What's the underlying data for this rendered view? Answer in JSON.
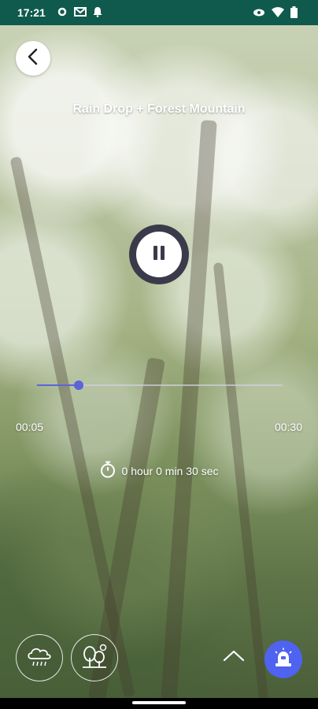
{
  "status_bar": {
    "time": "17:21",
    "left_icons": [
      "settings-icon",
      "gmail-icon",
      "notification-bell-icon"
    ],
    "right_icons": [
      "eye-icon",
      "wifi-icon",
      "battery-icon"
    ]
  },
  "player": {
    "title": "Rain Drop + Forest Mountain",
    "state": "playing",
    "progress_fraction": 0.17,
    "current_time": "00:05",
    "total_time": "00:30",
    "timer_text": "0 hour 0 min 30 sec"
  },
  "sounds": [
    {
      "icon": "rain-cloud-icon"
    },
    {
      "icon": "forest-trees-icon"
    }
  ],
  "colors": {
    "status_bar": "#0f5a4c",
    "accent": "#5b64d8",
    "alarm_button": "#4f62f0",
    "play_button": "#3b3a4a"
  }
}
